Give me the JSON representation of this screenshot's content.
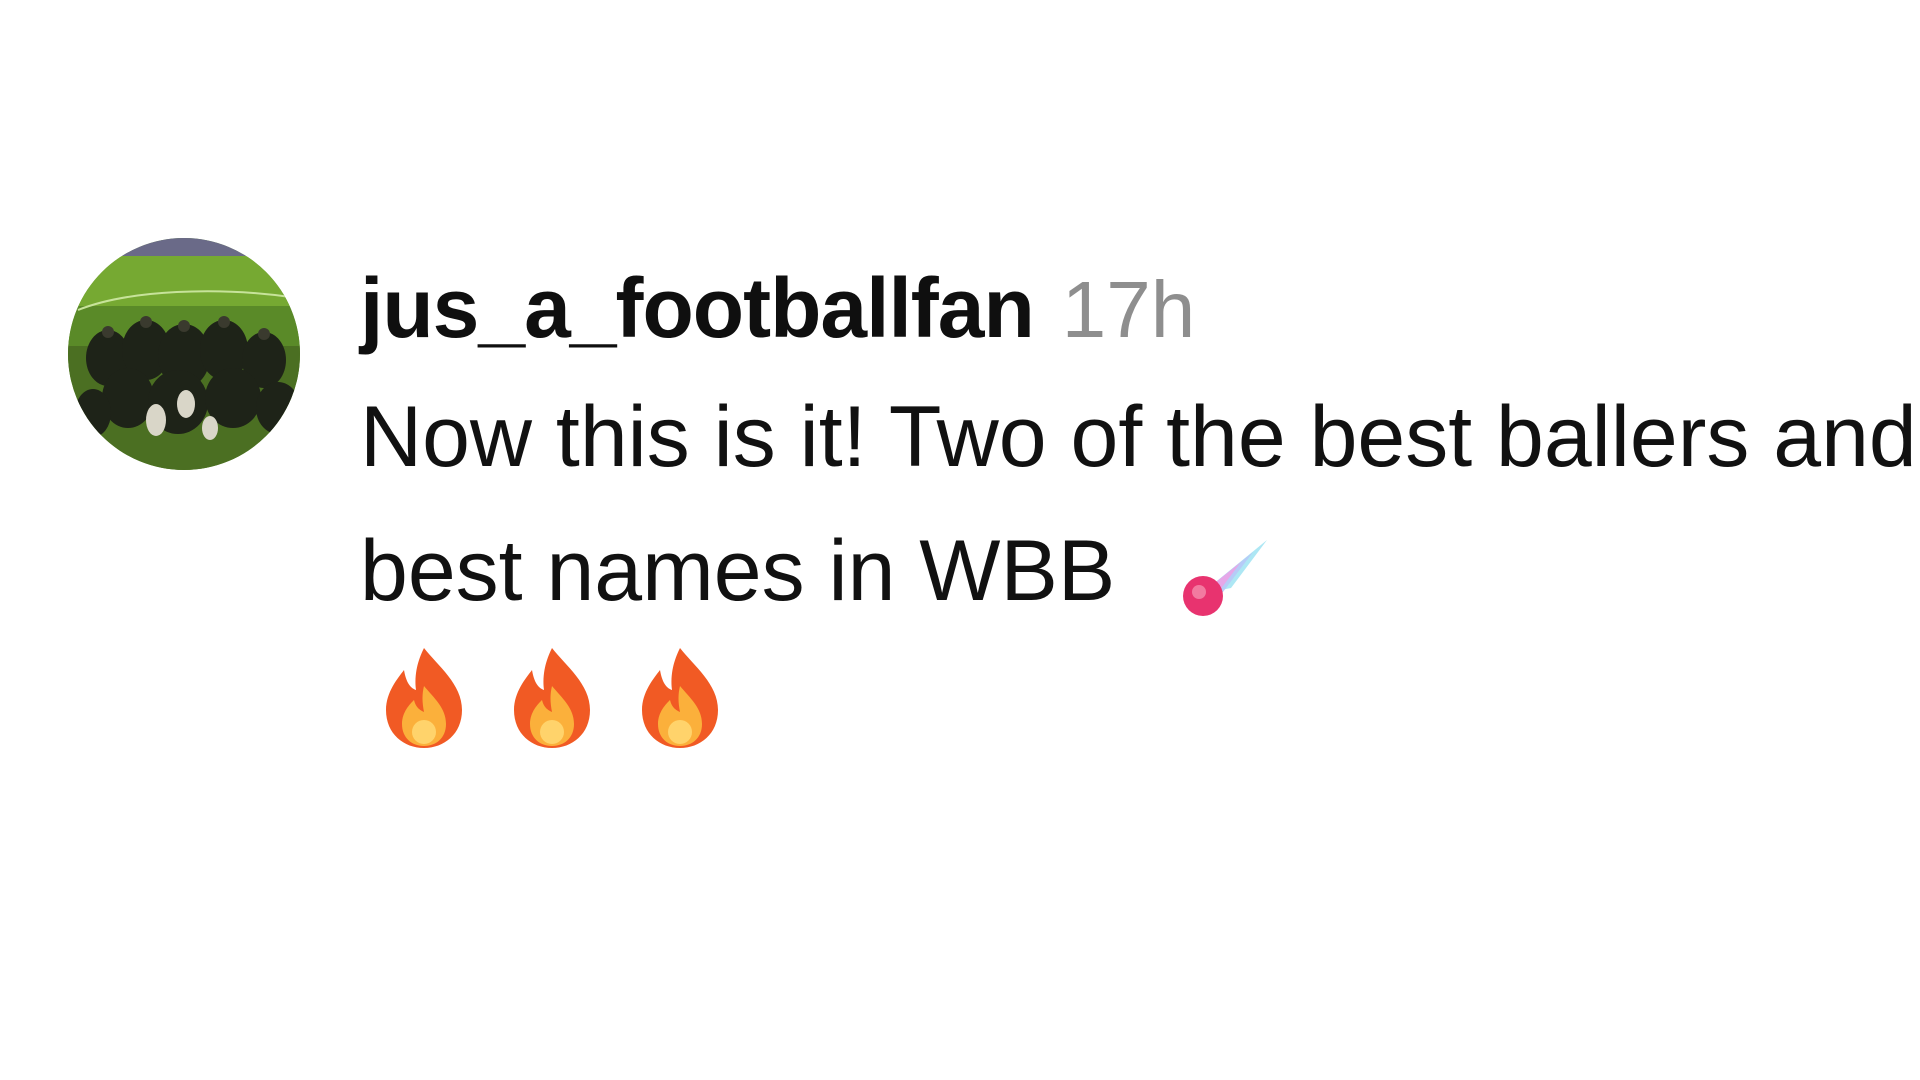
{
  "comment": {
    "avatar_icon": "profile-photo-football-pitch",
    "username": "jus_a_footballfan",
    "timestamp": "17h",
    "text": "Now this is it! Two of the best ballers and best names in WBB",
    "emojis": [
      "comet-icon",
      "fire-icon",
      "fire-icon",
      "fire-icon"
    ]
  },
  "colors": {
    "username": "#0f0f0f",
    "timestamp": "#8e8e8e",
    "text": "#111111",
    "fire_outer": "#f15a24",
    "fire_inner": "#fbb03b"
  }
}
